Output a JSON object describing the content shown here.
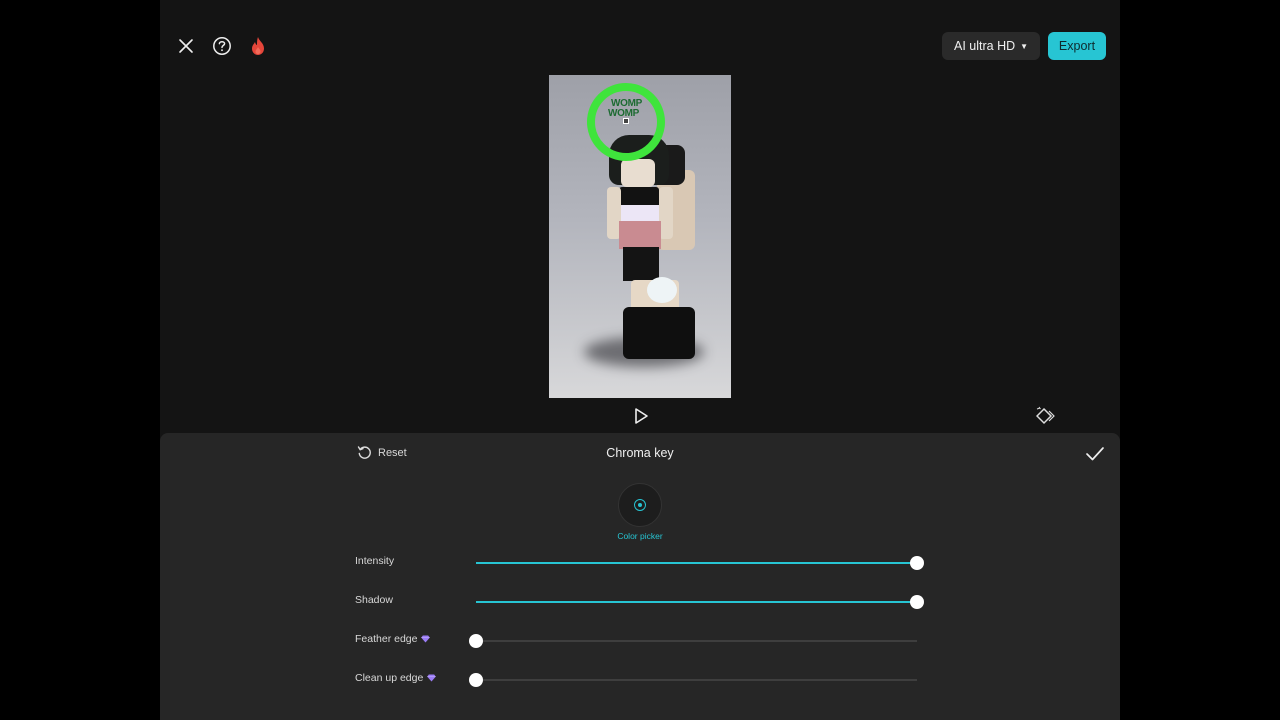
{
  "topbar": {
    "close_icon": "close-icon",
    "help_icon": "help-icon",
    "flame_icon": "flame-icon",
    "quality_label": "AI ultra HD",
    "export_label": "Export"
  },
  "preview": {
    "overlay_text_line1": "WOMP",
    "overlay_text_line2": "WOMP",
    "picked_color": "#3fe43c"
  },
  "playback": {
    "play_icon": "play-icon",
    "keyframe_icon": "keyframe-icon"
  },
  "panel": {
    "reset_label": "Reset",
    "title": "Chroma key",
    "color_picker_label": "Color picker",
    "sliders": [
      {
        "label": "Intensity",
        "value": 1.0,
        "premium": false
      },
      {
        "label": "Shadow",
        "value": 1.0,
        "premium": false
      },
      {
        "label": "Feather edge",
        "value": 0.0,
        "premium": true
      },
      {
        "label": "Clean up edge",
        "value": 0.0,
        "premium": true
      }
    ]
  },
  "colors": {
    "accent": "#27c5d3",
    "background": "#141414",
    "panel": "#262626",
    "premium_gem": "#9b7cf5"
  }
}
